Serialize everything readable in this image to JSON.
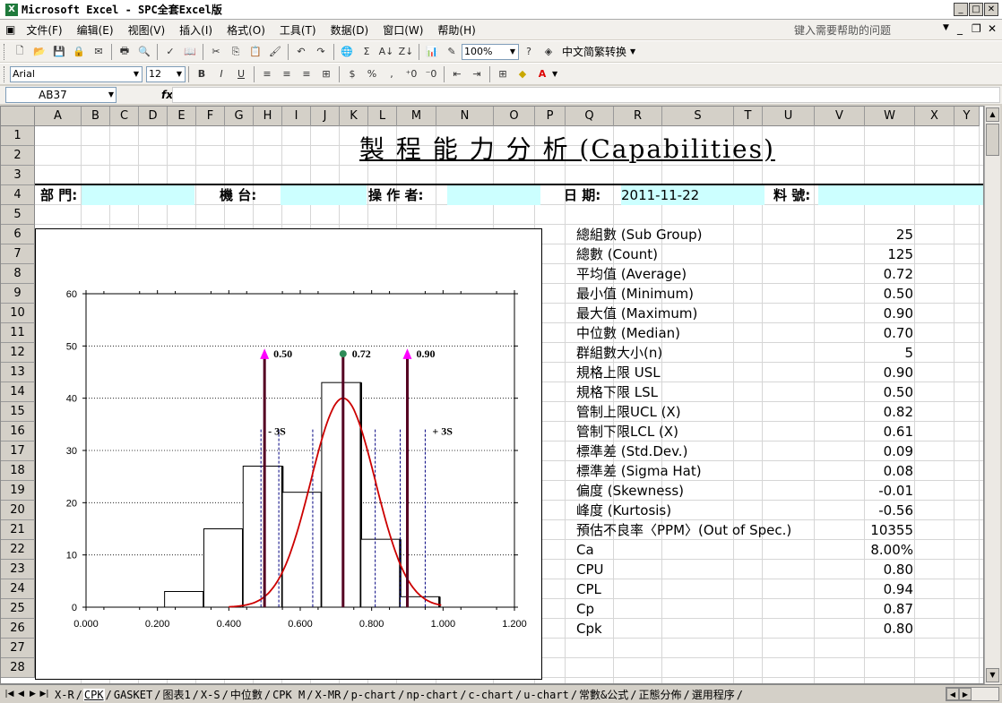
{
  "window": {
    "title": "Microsoft Excel - SPC全套Excel版"
  },
  "menu": {
    "items": [
      "文件(F)",
      "编辑(E)",
      "视图(V)",
      "插入(I)",
      "格式(O)",
      "工具(T)",
      "数据(D)",
      "窗口(W)",
      "帮助(H)"
    ],
    "help_placeholder": "键入需要帮助的问题"
  },
  "toolbar": {
    "zoom": "100%",
    "convert_label": "中文简繁转换",
    "font_name": "Arial",
    "font_size": "12"
  },
  "formula_bar": {
    "name_box": "AB37",
    "fx": "fx",
    "content": ""
  },
  "columns": [
    "A",
    "B",
    "C",
    "D",
    "E",
    "F",
    "G",
    "H",
    "I",
    "J",
    "K",
    "L",
    "M",
    "N",
    "O",
    "P",
    "Q",
    "R",
    "S",
    "T",
    "U",
    "V",
    "W",
    "X",
    "Y"
  ],
  "rows": [
    "1",
    "2",
    "3",
    "4",
    "5",
    "6",
    "7",
    "8",
    "9",
    "10",
    "11",
    "12",
    "13",
    "14",
    "15",
    "16",
    "17",
    "18",
    "19",
    "20",
    "21",
    "22",
    "23",
    "24",
    "25",
    "26",
    "27",
    "28"
  ],
  "sheet": {
    "title": "製 程 能 力 分 析 (Capabilities)",
    "header_fields": {
      "dept": "部 門:",
      "machine": "機 台:",
      "operator": "操 作 者:",
      "date_label": "日 期:",
      "date_value": "2011-11-22",
      "part": "料 號:"
    }
  },
  "stats": [
    {
      "label": "總組數 (Sub Group)",
      "value": "25"
    },
    {
      "label": "總數 (Count)",
      "value": "125"
    },
    {
      "label": "平均值 (Average)",
      "value": "0.72"
    },
    {
      "label": "最小值 (Minimum)",
      "value": "0.50"
    },
    {
      "label": "最大值 (Maximum)",
      "value": "0.90"
    },
    {
      "label": "中位數 (Median)",
      "value": "0.70"
    },
    {
      "label": "群組數大小(n)",
      "value": "5"
    },
    {
      "label": "規格上限 USL",
      "value": "0.90"
    },
    {
      "label": "規格下限 LSL",
      "value": "0.50"
    },
    {
      "label": "管制上限UCL (X)",
      "value": "0.82"
    },
    {
      "label": "管制下限LCL (X)",
      "value": "0.61"
    },
    {
      "label": "標準差 (Std.Dev.)",
      "value": "0.09"
    },
    {
      "label": "標準差 (Sigma Hat)",
      "value": "0.08"
    },
    {
      "label": "偏度 (Skewness)",
      "value": "-0.01"
    },
    {
      "label": "峰度 (Kurtosis)",
      "value": "-0.56"
    },
    {
      "label": "預估不良率〈PPM〉(Out of Spec.)",
      "value": "10355"
    },
    {
      "label": "Ca",
      "value": "8.00%"
    },
    {
      "label": "CPU",
      "value": "0.80"
    },
    {
      "label": "CPL",
      "value": "0.94"
    },
    {
      "label": "Cp",
      "value": "0.87"
    },
    {
      "label": "Cpk",
      "value": "0.80"
    }
  ],
  "chart_data": {
    "type": "bar",
    "title": "",
    "xlabel": "",
    "ylabel": "",
    "xlim": [
      0,
      1.2
    ],
    "ylim": [
      0,
      60
    ],
    "xticks": [
      "0.000",
      "0.200",
      "0.400",
      "0.600",
      "0.800",
      "1.000",
      "1.200"
    ],
    "yticks": [
      "0",
      "10",
      "20",
      "30",
      "40",
      "50",
      "60"
    ],
    "grid": true,
    "histogram": {
      "bins": [
        [
          0.22,
          0.33
        ],
        [
          0.33,
          0.44
        ],
        [
          0.44,
          0.55
        ],
        [
          0.55,
          0.66
        ],
        [
          0.66,
          0.77
        ],
        [
          0.77,
          0.88
        ],
        [
          0.88,
          0.99
        ]
      ],
      "counts": [
        3,
        15,
        27,
        22,
        43,
        13,
        2
      ]
    },
    "normal_curve": {
      "mean": 0.72,
      "sigma": 0.09,
      "peak": 40
    },
    "markers": [
      {
        "label": "0.50",
        "x": 0.5,
        "color": "#ff00ff"
      },
      {
        "label": "0.72",
        "x": 0.72,
        "color": "#2e8b57"
      },
      {
        "label": "0.90",
        "x": 0.9,
        "color": "#ff00ff"
      }
    ],
    "sigma_lines": [
      0.49,
      0.54,
      0.635,
      0.81,
      0.88,
      0.95
    ],
    "annotations": [
      {
        "text": "- 3S",
        "x": 0.51,
        "y": 33
      },
      {
        "text": "+ 3S",
        "x": 0.97,
        "y": 33
      }
    ],
    "colors": {
      "curve": "#cc0000",
      "spec": "#550022",
      "sigma": "#000080"
    }
  },
  "tabs": {
    "items": [
      "X-R",
      "CPK",
      "GASKET",
      "图表1",
      "X-S",
      "中位數",
      "CPK M",
      "X-MR",
      "p-chart",
      "np-chart",
      "c-chart",
      "u-chart",
      "常數&公式",
      "正態分佈",
      "選用程序"
    ],
    "active": "CPK"
  }
}
